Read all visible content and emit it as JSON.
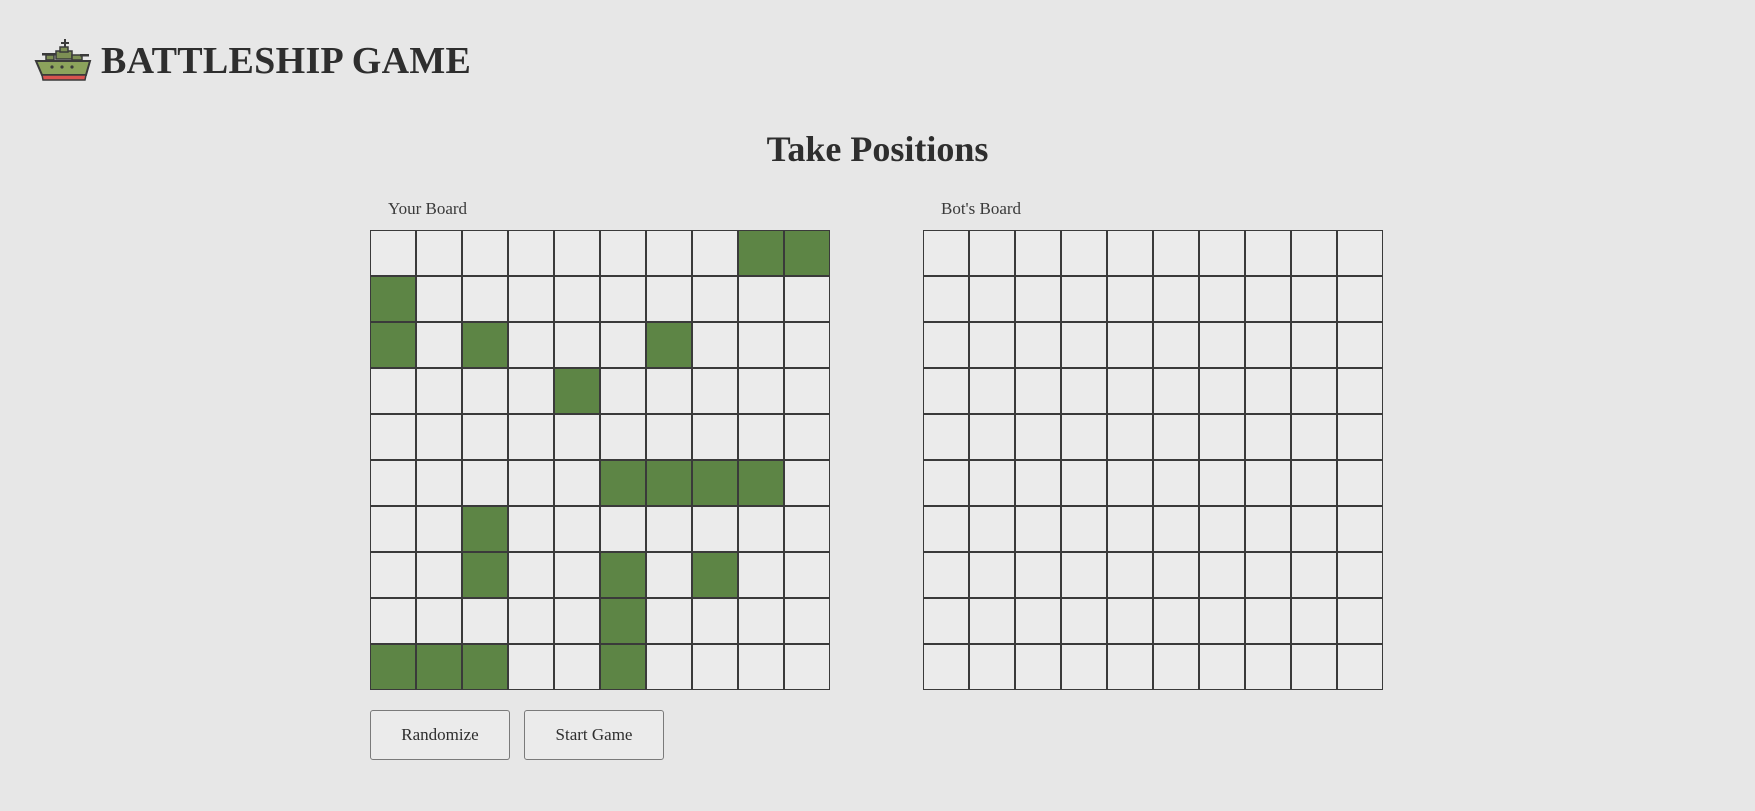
{
  "app": {
    "title": "BATTLESHIP GAME",
    "logo_icon": "battleship-icon"
  },
  "page_title": "Take Positions",
  "player_board": {
    "label": "Your Board",
    "rows": 10,
    "cols": 10,
    "ship_color": "#5d8545",
    "ship_cells": [
      [
        0,
        8
      ],
      [
        0,
        9
      ],
      [
        1,
        0
      ],
      [
        2,
        0
      ],
      [
        2,
        2
      ],
      [
        2,
        6
      ],
      [
        3,
        4
      ],
      [
        5,
        5
      ],
      [
        5,
        6
      ],
      [
        5,
        7
      ],
      [
        5,
        8
      ],
      [
        6,
        2
      ],
      [
        7,
        2
      ],
      [
        7,
        5
      ],
      [
        7,
        7
      ],
      [
        8,
        5
      ],
      [
        9,
        0
      ],
      [
        9,
        1
      ],
      [
        9,
        2
      ],
      [
        9,
        5
      ]
    ]
  },
  "bot_board": {
    "label": "Bot's Board",
    "rows": 10,
    "cols": 10
  },
  "buttons": {
    "randomize_label": "Randomize",
    "start_label": "Start Game"
  }
}
